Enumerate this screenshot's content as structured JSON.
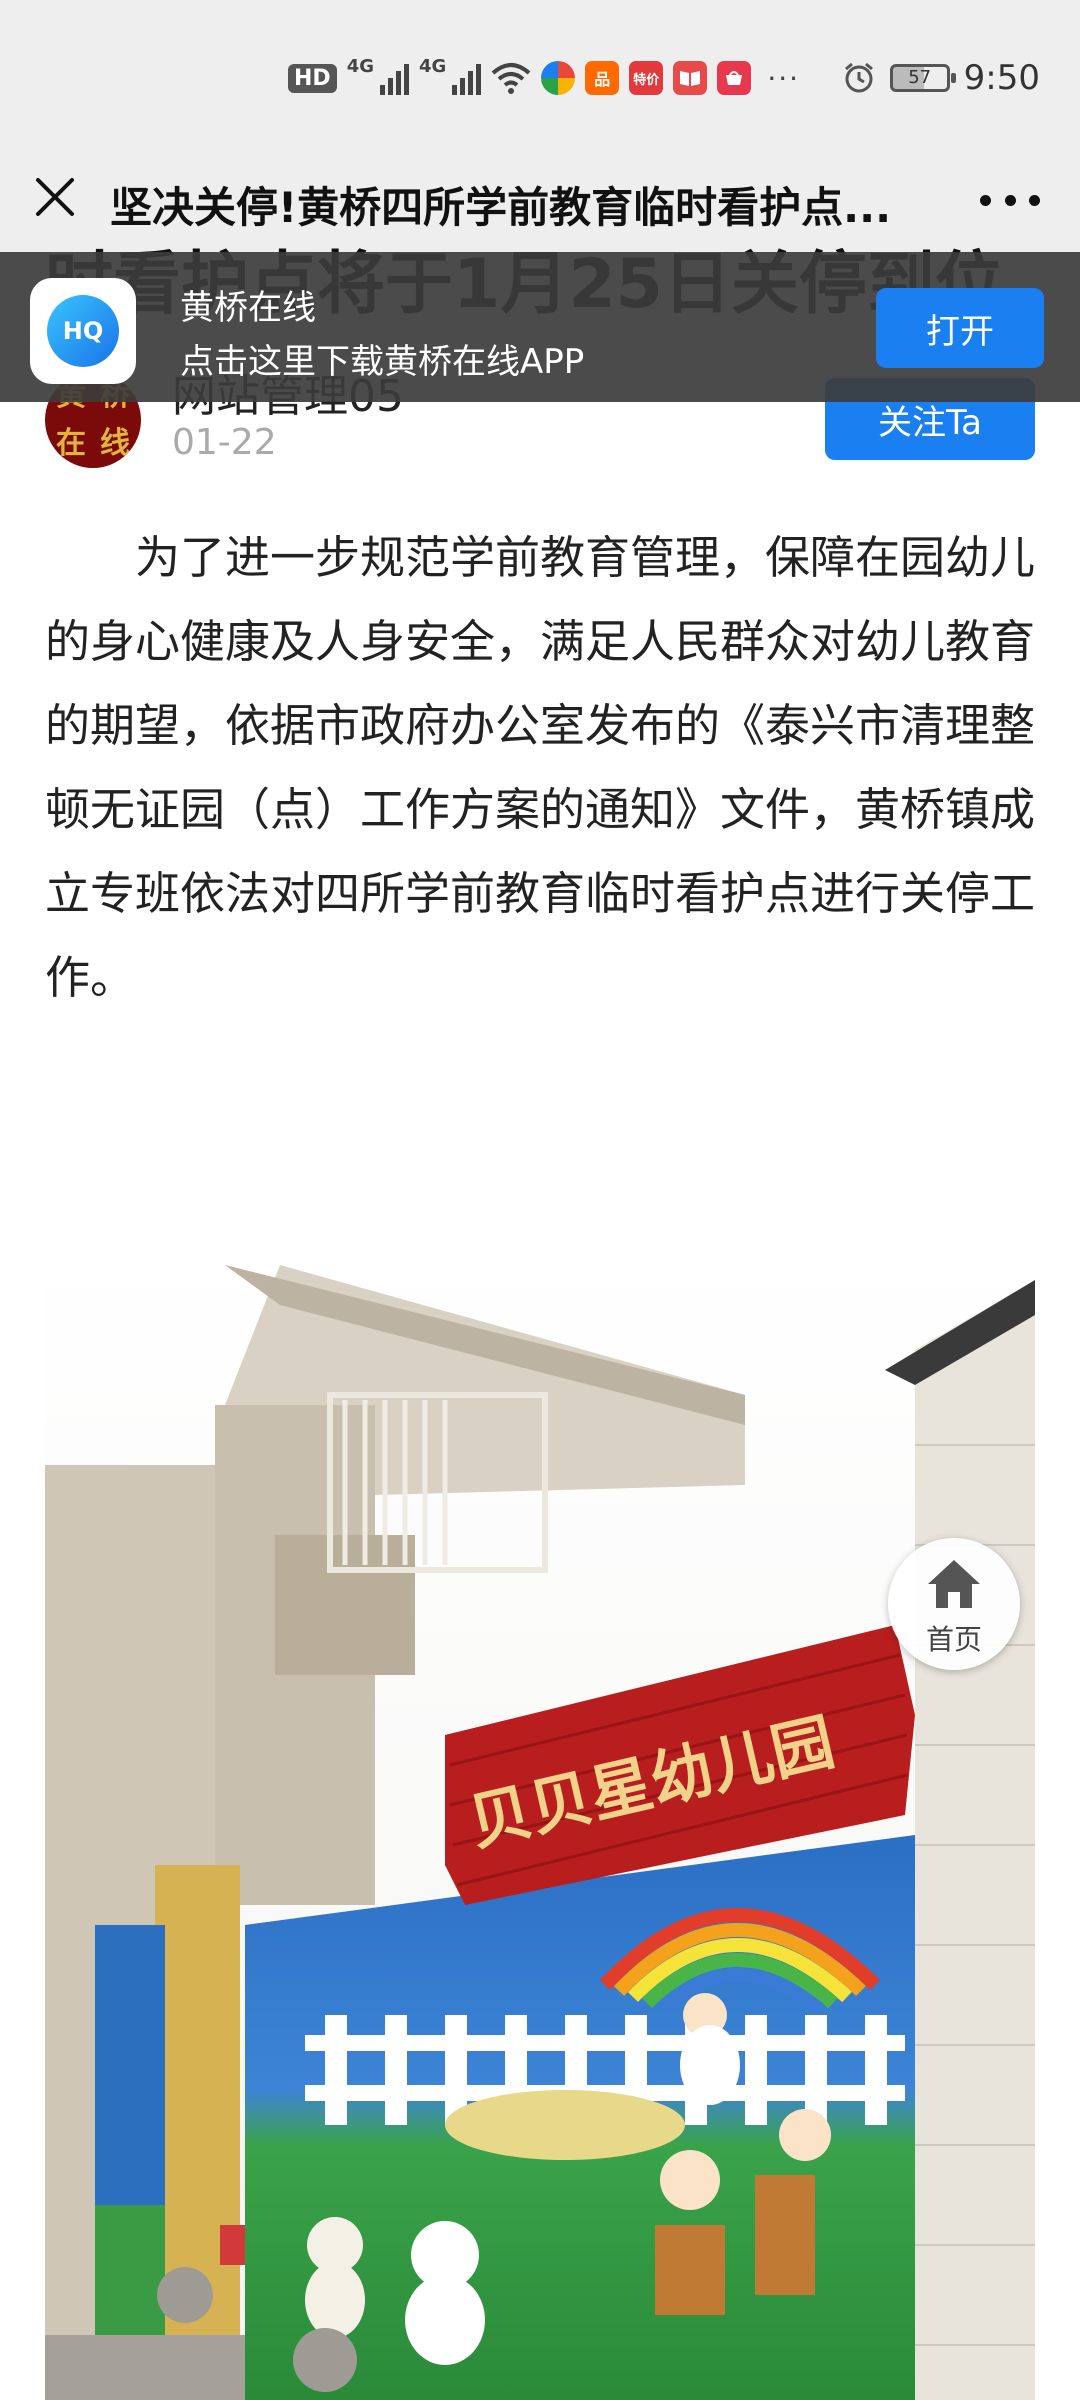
{
  "status_bar": {
    "hd_label": "HD",
    "net1": "4G",
    "net2": "4G",
    "battery": "57",
    "time": "9:50",
    "overflow": "···",
    "app_icons": [
      {
        "name": "browser-app-icon",
        "color": "#e8473c",
        "text": ""
      },
      {
        "name": "taobao-app-icon",
        "color": "#ff6a00",
        "text": "品"
      },
      {
        "name": "tejia-app-icon",
        "color": "#e4393c",
        "text": "特价"
      },
      {
        "name": "reader-app-icon",
        "color": "#e84a4a",
        "text": "📖"
      },
      {
        "name": "huawei-app-icon",
        "color": "#e8384d",
        "text": ""
      }
    ]
  },
  "title_bar": {
    "title": "坚决关停!黄桥四所学前教育临时看护点..."
  },
  "peek_title": "时看护点将于1月25日关停到位",
  "banner": {
    "app_name": "黄桥在线",
    "description": "点击这里下载黄桥在线APP",
    "open_label": "打开",
    "logo_text": "HQ"
  },
  "author": {
    "avatar_text": [
      "黄",
      "桥",
      "在",
      "线"
    ],
    "name": "网站管理05",
    "date": "01-22",
    "follow_label": "关注Ta"
  },
  "article": {
    "paragraph": "为了进一步规范学前教育管理，保障在园幼儿的身心健康及人身安全，满足人民群众对幼儿教育的期望，依据市政府办公室发布的《泰兴市清理整顿无证园（点）工作方案的通知》文件，黄桥镇成立专班依法对四所学前教育临时看护点进行关停工作。"
  },
  "photo": {
    "sign_text": "贝贝星幼儿园"
  },
  "home_fab": {
    "label": "首页"
  },
  "colors": {
    "accent": "#1a7ff0",
    "banner_bg": "#3c3c3c",
    "sign_red": "#b81e1e",
    "sign_gold": "#f1d28a"
  }
}
